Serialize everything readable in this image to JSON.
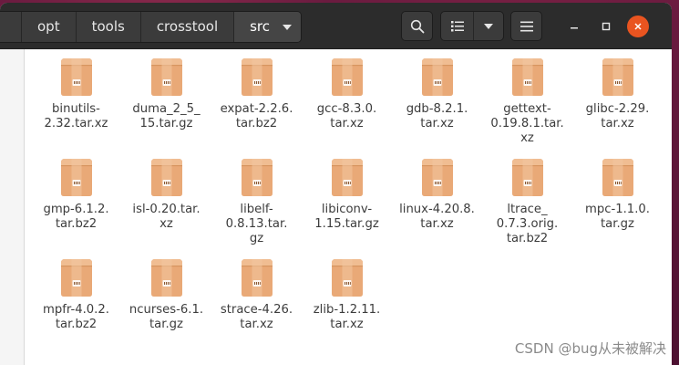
{
  "pathbar": {
    "crumbs": [
      "opt",
      "tools",
      "crosstool"
    ],
    "current": "src"
  },
  "toolbar": {
    "search_icon": "search-icon",
    "view_icon": "list-view-icon",
    "menu_icon": "hamburger-menu-icon"
  },
  "window_controls": [
    "minimize-icon",
    "maximize-icon",
    "close-icon"
  ],
  "files": [
    {
      "name": "binutils-2.32.tar.xz",
      "lines": [
        "binutils-",
        "2.32.tar.xz"
      ]
    },
    {
      "name": "duma_2_5_15.tar.gz",
      "lines": [
        "duma_2_5_",
        "15.tar.gz"
      ]
    },
    {
      "name": "expat-2.2.6.tar.bz2",
      "lines": [
        "expat-2.2.6.",
        "tar.bz2"
      ]
    },
    {
      "name": "gcc-8.3.0.tar.xz",
      "lines": [
        "gcc-8.3.0.",
        "tar.xz"
      ]
    },
    {
      "name": "gdb-8.2.1.tar.xz",
      "lines": [
        "gdb-8.2.1.",
        "tar.xz"
      ]
    },
    {
      "name": "gettext-0.19.8.1.tar.xz",
      "lines": [
        "gettext-",
        "0.19.8.1.tar.",
        "xz"
      ]
    },
    {
      "name": "glibc-2.29.tar.xz",
      "lines": [
        "glibc-2.29.",
        "tar.xz"
      ]
    },
    {
      "name": "gmp-6.1.2.tar.bz2",
      "lines": [
        "gmp-6.1.2.",
        "tar.bz2"
      ]
    },
    {
      "name": "isl-0.20.tar.xz",
      "lines": [
        "isl-0.20.tar.",
        "xz"
      ]
    },
    {
      "name": "libelf-0.8.13.tar.gz",
      "lines": [
        "libelf-",
        "0.8.13.tar.",
        "gz"
      ]
    },
    {
      "name": "libiconv-1.15.tar.gz",
      "lines": [
        "libiconv-",
        "1.15.tar.gz"
      ]
    },
    {
      "name": "linux-4.20.8.tar.xz",
      "lines": [
        "linux-4.20.8.",
        "tar.xz"
      ]
    },
    {
      "name": "ltrace_0.7.3.orig.tar.bz2",
      "lines": [
        "ltrace_",
        "0.7.3.orig.",
        "tar.bz2"
      ]
    },
    {
      "name": "mpc-1.1.0.tar.gz",
      "lines": [
        "mpc-1.1.0.",
        "tar.gz"
      ]
    },
    {
      "name": "mpfr-4.0.2.tar.bz2",
      "lines": [
        "mpfr-4.0.2.",
        "tar.bz2"
      ]
    },
    {
      "name": "ncurses-6.1.tar.gz",
      "lines": [
        "ncurses-6.1.",
        "tar.gz"
      ]
    },
    {
      "name": "strace-4.26.tar.xz",
      "lines": [
        "strace-4.26.",
        "tar.xz"
      ]
    },
    {
      "name": "zlib-1.2.11.tar.xz",
      "lines": [
        "zlib-1.2.11.",
        "tar.xz"
      ]
    }
  ],
  "file_icon": "archive-box-icon",
  "watermark": "CSDN @bug从未被解决",
  "colors": {
    "accent": "#e95420",
    "archive": "#e9a977",
    "headerbar": "#2c2c2c"
  }
}
